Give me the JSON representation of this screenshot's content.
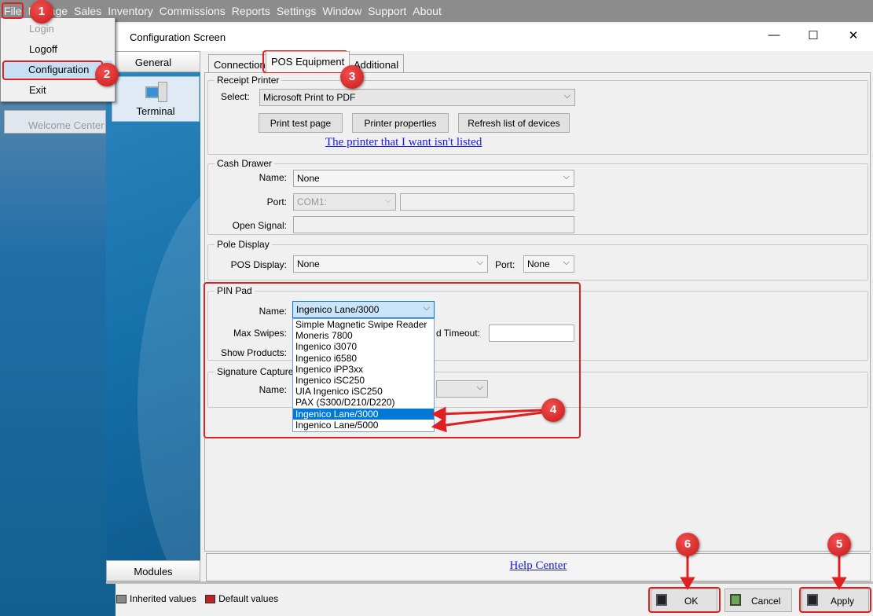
{
  "menubar": {
    "items": [
      "File",
      "Manage",
      "Sales",
      "Inventory",
      "Commissions",
      "Reports",
      "Settings",
      "Window",
      "Support",
      "About"
    ]
  },
  "file_menu": {
    "items": [
      "Login",
      "Logoff",
      "Configuration",
      "Exit"
    ]
  },
  "background": {
    "welcome_tab": "Welcome Center"
  },
  "window": {
    "title": "Configuration Screen",
    "minimize": "—",
    "maximize": "☐",
    "close": "✕"
  },
  "nav": {
    "general": "General",
    "terminal": "Terminal",
    "modules": "Modules"
  },
  "tabs": [
    "Connection",
    "POS Equipment",
    "Additional"
  ],
  "receipt_printer": {
    "title": "Receipt Printer",
    "select_label": "Select:",
    "select_value": "Microsoft Print to PDF",
    "buttons": [
      "Print test page",
      "Printer properties",
      "Refresh list of devices"
    ],
    "link": "The printer that I want isn't listed"
  },
  "cash_drawer": {
    "title": "Cash Drawer",
    "name_label": "Name:",
    "name_value": "None",
    "port_label": "Port:",
    "port_value": "COM1:",
    "open_signal_label": "Open Signal:"
  },
  "pole_display": {
    "title": "Pole Display",
    "pos_display_label": "POS Display:",
    "pos_display_value": "None",
    "port_label": "Port:",
    "port_value": "None"
  },
  "pin_pad": {
    "title": "PIN Pad",
    "name_label": "Name:",
    "name_value": "Ingenico Lane/3000",
    "max_swipes_label": "Max Swipes:",
    "timeout_label": "d Timeout:",
    "show_products_label": "Show Products:",
    "options": [
      "Simple Magnetic Swipe Reader",
      "Moneris 7800",
      "Ingenico i3070",
      "Ingenico i6580",
      "Ingenico iPP3xx",
      "Ingenico iSC250",
      "UIA Ingenico iSC250",
      "PAX (S300/D210/D220)",
      "Ingenico Lane/3000",
      "Ingenico Lane/5000"
    ]
  },
  "signature_capture": {
    "title": "Signature Capture",
    "name_label": "Name:"
  },
  "help_center": "Help Center",
  "legend": {
    "inherited": "Inherited values",
    "default": "Default values"
  },
  "buttons": {
    "ok": "OK",
    "cancel": "Cancel",
    "apply": "Apply"
  },
  "annotations": [
    "1",
    "2",
    "3",
    "4",
    "5",
    "6"
  ],
  "colors": {
    "annotation": "#e02020",
    "selection": "#0078d7",
    "link": "#1a1ae6"
  }
}
